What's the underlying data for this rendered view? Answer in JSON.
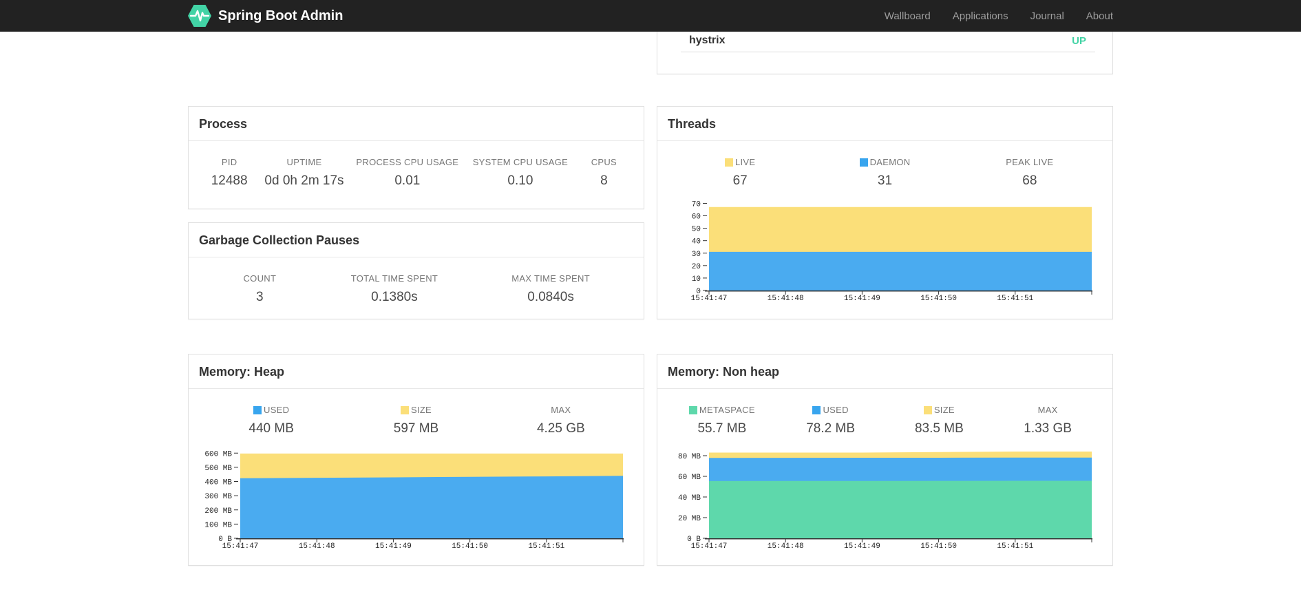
{
  "navbar": {
    "brand": "Spring Boot Admin",
    "links": [
      {
        "label": "Wallboard"
      },
      {
        "label": "Applications"
      },
      {
        "label": "Journal"
      },
      {
        "label": "About"
      }
    ]
  },
  "application_status": {
    "name": "hystrix",
    "status": "UP"
  },
  "panels": {
    "process": {
      "title": "Process",
      "metrics": [
        {
          "label": "PID",
          "value": "12488"
        },
        {
          "label": "UPTIME",
          "value": "0d 0h 2m 17s"
        },
        {
          "label": "PROCESS CPU USAGE",
          "value": "0.01"
        },
        {
          "label": "SYSTEM CPU USAGE",
          "value": "0.10"
        },
        {
          "label": "CPUS",
          "value": "8"
        }
      ]
    },
    "gc": {
      "title": "Garbage Collection Pauses",
      "metrics": [
        {
          "label": "COUNT",
          "value": "3"
        },
        {
          "label": "TOTAL TIME SPENT",
          "value": "0.1380s"
        },
        {
          "label": "MAX TIME SPENT",
          "value": "0.0840s"
        }
      ]
    },
    "threads": {
      "title": "Threads",
      "metrics": [
        {
          "label": "LIVE",
          "value": "67",
          "swatch": "#fbdf79"
        },
        {
          "label": "DAEMON",
          "value": "31",
          "swatch": "#38a5ee"
        },
        {
          "label": "PEAK LIVE",
          "value": "68"
        }
      ]
    },
    "heap": {
      "title": "Memory: Heap",
      "metrics": [
        {
          "label": "USED",
          "value": "440 MB",
          "swatch": "#38a5ee"
        },
        {
          "label": "SIZE",
          "value": "597 MB",
          "swatch": "#fbdf79"
        },
        {
          "label": "MAX",
          "value": "4.25 GB"
        }
      ]
    },
    "nonheap": {
      "title": "Memory: Non heap",
      "metrics": [
        {
          "label": "METASPACE",
          "value": "55.7 MB",
          "swatch": "#5ed8ab"
        },
        {
          "label": "USED",
          "value": "78.2 MB",
          "swatch": "#38a5ee"
        },
        {
          "label": "SIZE",
          "value": "83.5 MB",
          "swatch": "#fbdf79"
        },
        {
          "label": "MAX",
          "value": "1.33 GB"
        }
      ]
    }
  },
  "chart_data": [
    {
      "id": "threads",
      "type": "area",
      "title": "Threads",
      "x_labels": [
        "15:41:47",
        "15:41:48",
        "15:41:49",
        "15:41:50",
        "15:41:51"
      ],
      "ylim": [
        0,
        73
      ],
      "yticks": [
        {
          "v": 0,
          "label": "0"
        },
        {
          "v": 10,
          "label": "10"
        },
        {
          "v": 20,
          "label": "20"
        },
        {
          "v": 30,
          "label": "30"
        },
        {
          "v": 40,
          "label": "40"
        },
        {
          "v": 50,
          "label": "50"
        },
        {
          "v": 60,
          "label": "60"
        },
        {
          "v": 70,
          "label": "70"
        }
      ],
      "grid": false,
      "legend_position": "top",
      "series": [
        {
          "name": "LIVE",
          "color": "#fbdf79",
          "values": [
            67,
            67,
            67,
            67,
            67,
            67
          ]
        },
        {
          "name": "DAEMON",
          "color": "#4aabf0",
          "values": [
            31,
            31,
            31,
            31,
            31,
            31
          ]
        }
      ]
    },
    {
      "id": "memory-heap",
      "type": "area",
      "title": "Memory: Heap",
      "x_labels": [
        "15:41:47",
        "15:41:48",
        "15:41:49",
        "15:41:50",
        "15:41:51"
      ],
      "ylim": [
        0,
        640
      ],
      "yticks": [
        {
          "v": 0,
          "label": "0 B"
        },
        {
          "v": 100,
          "label": "100 MB"
        },
        {
          "v": 200,
          "label": "200 MB"
        },
        {
          "v": 300,
          "label": "300 MB"
        },
        {
          "v": 400,
          "label": "400 MB"
        },
        {
          "v": 500,
          "label": "500 MB"
        },
        {
          "v": 600,
          "label": "600 MB"
        }
      ],
      "grid": false,
      "legend_position": "top",
      "series": [
        {
          "name": "SIZE",
          "color": "#fbdf79",
          "values": [
            597,
            597,
            597,
            597,
            597,
            597
          ]
        },
        {
          "name": "USED",
          "color": "#4aabf0",
          "values": [
            423,
            426,
            429,
            433,
            436,
            440
          ]
        }
      ]
    },
    {
      "id": "memory-nonheap",
      "type": "area",
      "title": "Memory: Non heap",
      "x_labels": [
        "15:41:47",
        "15:41:48",
        "15:41:49",
        "15:41:50",
        "15:41:51"
      ],
      "ylim": [
        0,
        88
      ],
      "yticks": [
        {
          "v": 0,
          "label": "0 B"
        },
        {
          "v": 20,
          "label": "20 MB"
        },
        {
          "v": 40,
          "label": "40 MB"
        },
        {
          "v": 60,
          "label": "60 MB"
        },
        {
          "v": 80,
          "label": "80 MB"
        }
      ],
      "grid": false,
      "legend_position": "top",
      "series": [
        {
          "name": "SIZE",
          "color": "#fbdf79",
          "values": [
            83,
            83,
            83,
            83.5,
            84,
            84
          ]
        },
        {
          "name": "USED",
          "color": "#4aabf0",
          "values": [
            77.8,
            77.9,
            78,
            78,
            78.2,
            78.2
          ]
        },
        {
          "name": "METASPACE",
          "color": "#5ed8ab",
          "values": [
            55.4,
            55.5,
            55.5,
            55.6,
            55.7,
            55.7
          ]
        }
      ]
    }
  ],
  "colors": {
    "navbar_bg": "#222222",
    "brand_green": "#42d3a5",
    "status_up": "#42d3a5",
    "chart_yellow": "#fbdf79",
    "chart_blue": "#4aabf0",
    "chart_green": "#5ed8ab"
  }
}
